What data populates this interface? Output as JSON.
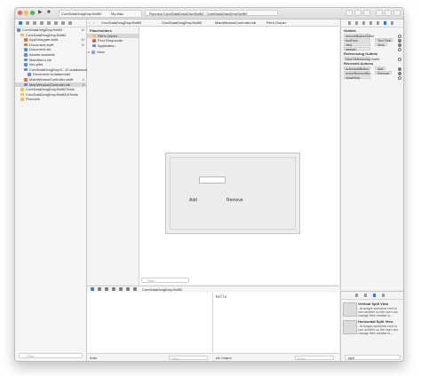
{
  "toolbar": {
    "project": "CoreDataDragDropSwift2",
    "destination": "My Mac",
    "activity": "Running CoreDataDragDropSwift2 : CoreDataDragDropSwift2"
  },
  "navigator": {
    "items": [
      {
        "label": "CoreDataDragDropSwift2",
        "badge": "M",
        "kind": "project"
      },
      {
        "label": "CoreDataDragDropSwift2",
        "badge": "",
        "kind": "folder"
      },
      {
        "label": "AppDelegate.swift",
        "badge": "M",
        "kind": "file"
      },
      {
        "label": "Document.swift",
        "badge": "M",
        "kind": "file"
      },
      {
        "label": "Document.xib",
        "badge": "",
        "kind": "file"
      },
      {
        "label": "Assets.xcassets",
        "badge": "",
        "kind": "file"
      },
      {
        "label": "MainMenu.xib",
        "badge": "",
        "kind": "file"
      },
      {
        "label": "Info.plist",
        "badge": "",
        "kind": "file"
      },
      {
        "label": "CoreDataDragDropS...t2.xcdatamodeld",
        "badge": "",
        "kind": "file"
      },
      {
        "label": "Document.xcdatamodel",
        "badge": "",
        "kind": "file"
      },
      {
        "label": "MainWindowController.swift",
        "badge": "A",
        "kind": "file"
      },
      {
        "label": "MainWindowController.xib",
        "badge": "A",
        "kind": "file"
      },
      {
        "label": "CoreDataDragDropSwift2Tests",
        "badge": "",
        "kind": "folder"
      },
      {
        "label": "CoreDataDragDropSwift2UITests",
        "badge": "",
        "kind": "folder"
      },
      {
        "label": "Products",
        "badge": "",
        "kind": "folder"
      }
    ],
    "filter_placeholder": "Filter"
  },
  "jumpbar": {
    "crumbs": [
      "CoreDataDragDropSwift2",
      "CoreDataDragDropSwift2",
      "MainWindowController.xib",
      "File's Owner"
    ]
  },
  "outline": {
    "placeholders_header": "Placeholders",
    "placeholders": [
      "File's Owner",
      "First Responder",
      "Application"
    ],
    "objects": [
      "View"
    ],
    "filter_placeholder": "Filter"
  },
  "ib": {
    "add_label": "Add",
    "remove_label": "Remove"
  },
  "debug": {
    "scheme": "CoreDataDragDropSwift2",
    "console_output": "hello",
    "auto_label": "Auto",
    "output_label": "All Output",
    "vars_filter": "Filter",
    "console_filter": "Filter"
  },
  "inspector": {
    "outlets_header": "Outlets",
    "outlets": [
      {
        "key": "removeButtonOutlet",
        "value": "",
        "connected": false
      },
      {
        "key": "textField",
        "value": "Text Field",
        "connected": true
      },
      {
        "key": "view",
        "value": "View",
        "connected": true
      },
      {
        "key": "window",
        "value": "",
        "connected": false
      }
    ],
    "ref_outlets_header": "Referencing Outlets",
    "ref_outlets": [
      {
        "key": "New Referencing Outlet",
        "value": "",
        "connected": false
      }
    ],
    "received_header": "Received Actions",
    "received": [
      {
        "key": "actionAddButton",
        "value": "Add",
        "connected": true
      },
      {
        "key": "actionRemoveBu...",
        "value": "Remove",
        "connected": true
      },
      {
        "key": "showHelp:",
        "value": "",
        "connected": false
      }
    ]
  },
  "library": {
    "items": [
      {
        "title": "Vertical Split View",
        "desc": "- Arranges subviews next to one another so the user can change their relative si..."
      },
      {
        "title": "Horizontal Split View",
        "desc": "- Arranges subviews next to one another so the user can change their relative si..."
      }
    ],
    "filter_value": "split"
  },
  "colors": {
    "accent": "#2f7de1",
    "folder": "#f3c04a",
    "swift_file": "#e5733d",
    "xib_file": "#5b8fd9"
  }
}
